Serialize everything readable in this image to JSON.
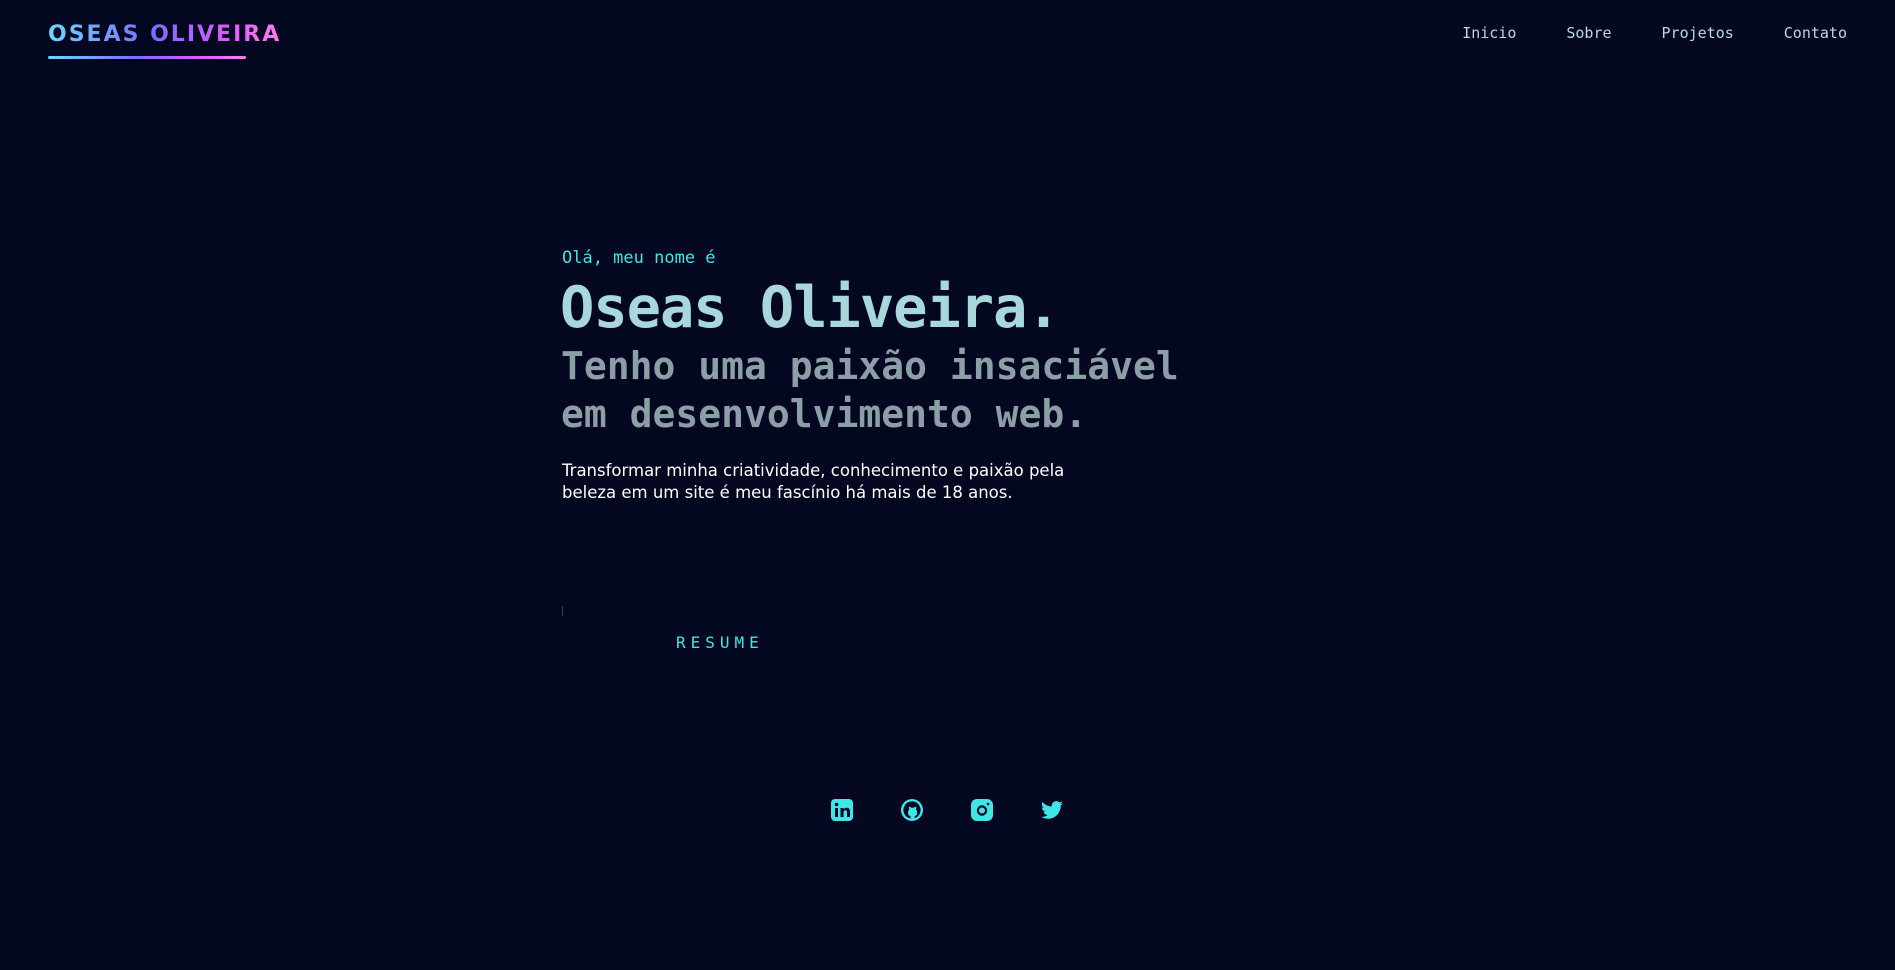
{
  "header": {
    "logo": "OSEAS OLIVEIRA",
    "nav": [
      {
        "label": "Inicio"
      },
      {
        "label": "Sobre"
      },
      {
        "label": "Projetos"
      },
      {
        "label": "Contato"
      }
    ]
  },
  "hero": {
    "greeting": "Olá, meu nome é",
    "name": "Oseas Oliveira.",
    "tagline": "Tenho uma paixão insaciável em desenvolvimento web.",
    "description": "Transformar minha criatividade, conhecimento e paixão pela beleza em um site é meu fascínio há mais de 18 anos.",
    "resume_label": "RESUME"
  },
  "social": [
    {
      "icon": "linkedin-icon"
    },
    {
      "icon": "github-icon"
    },
    {
      "icon": "instagram-icon"
    },
    {
      "icon": "twitter-icon"
    }
  ],
  "colors": {
    "background": "#030720",
    "accent": "#3fe6e6",
    "name": "#a9d8dc",
    "tagline": "#8c9ea6",
    "nav": "#b7dbe2",
    "logo_gradient": [
      "#6fd6ff",
      "#7c6cff",
      "#d65bff",
      "#ff7de9"
    ]
  }
}
